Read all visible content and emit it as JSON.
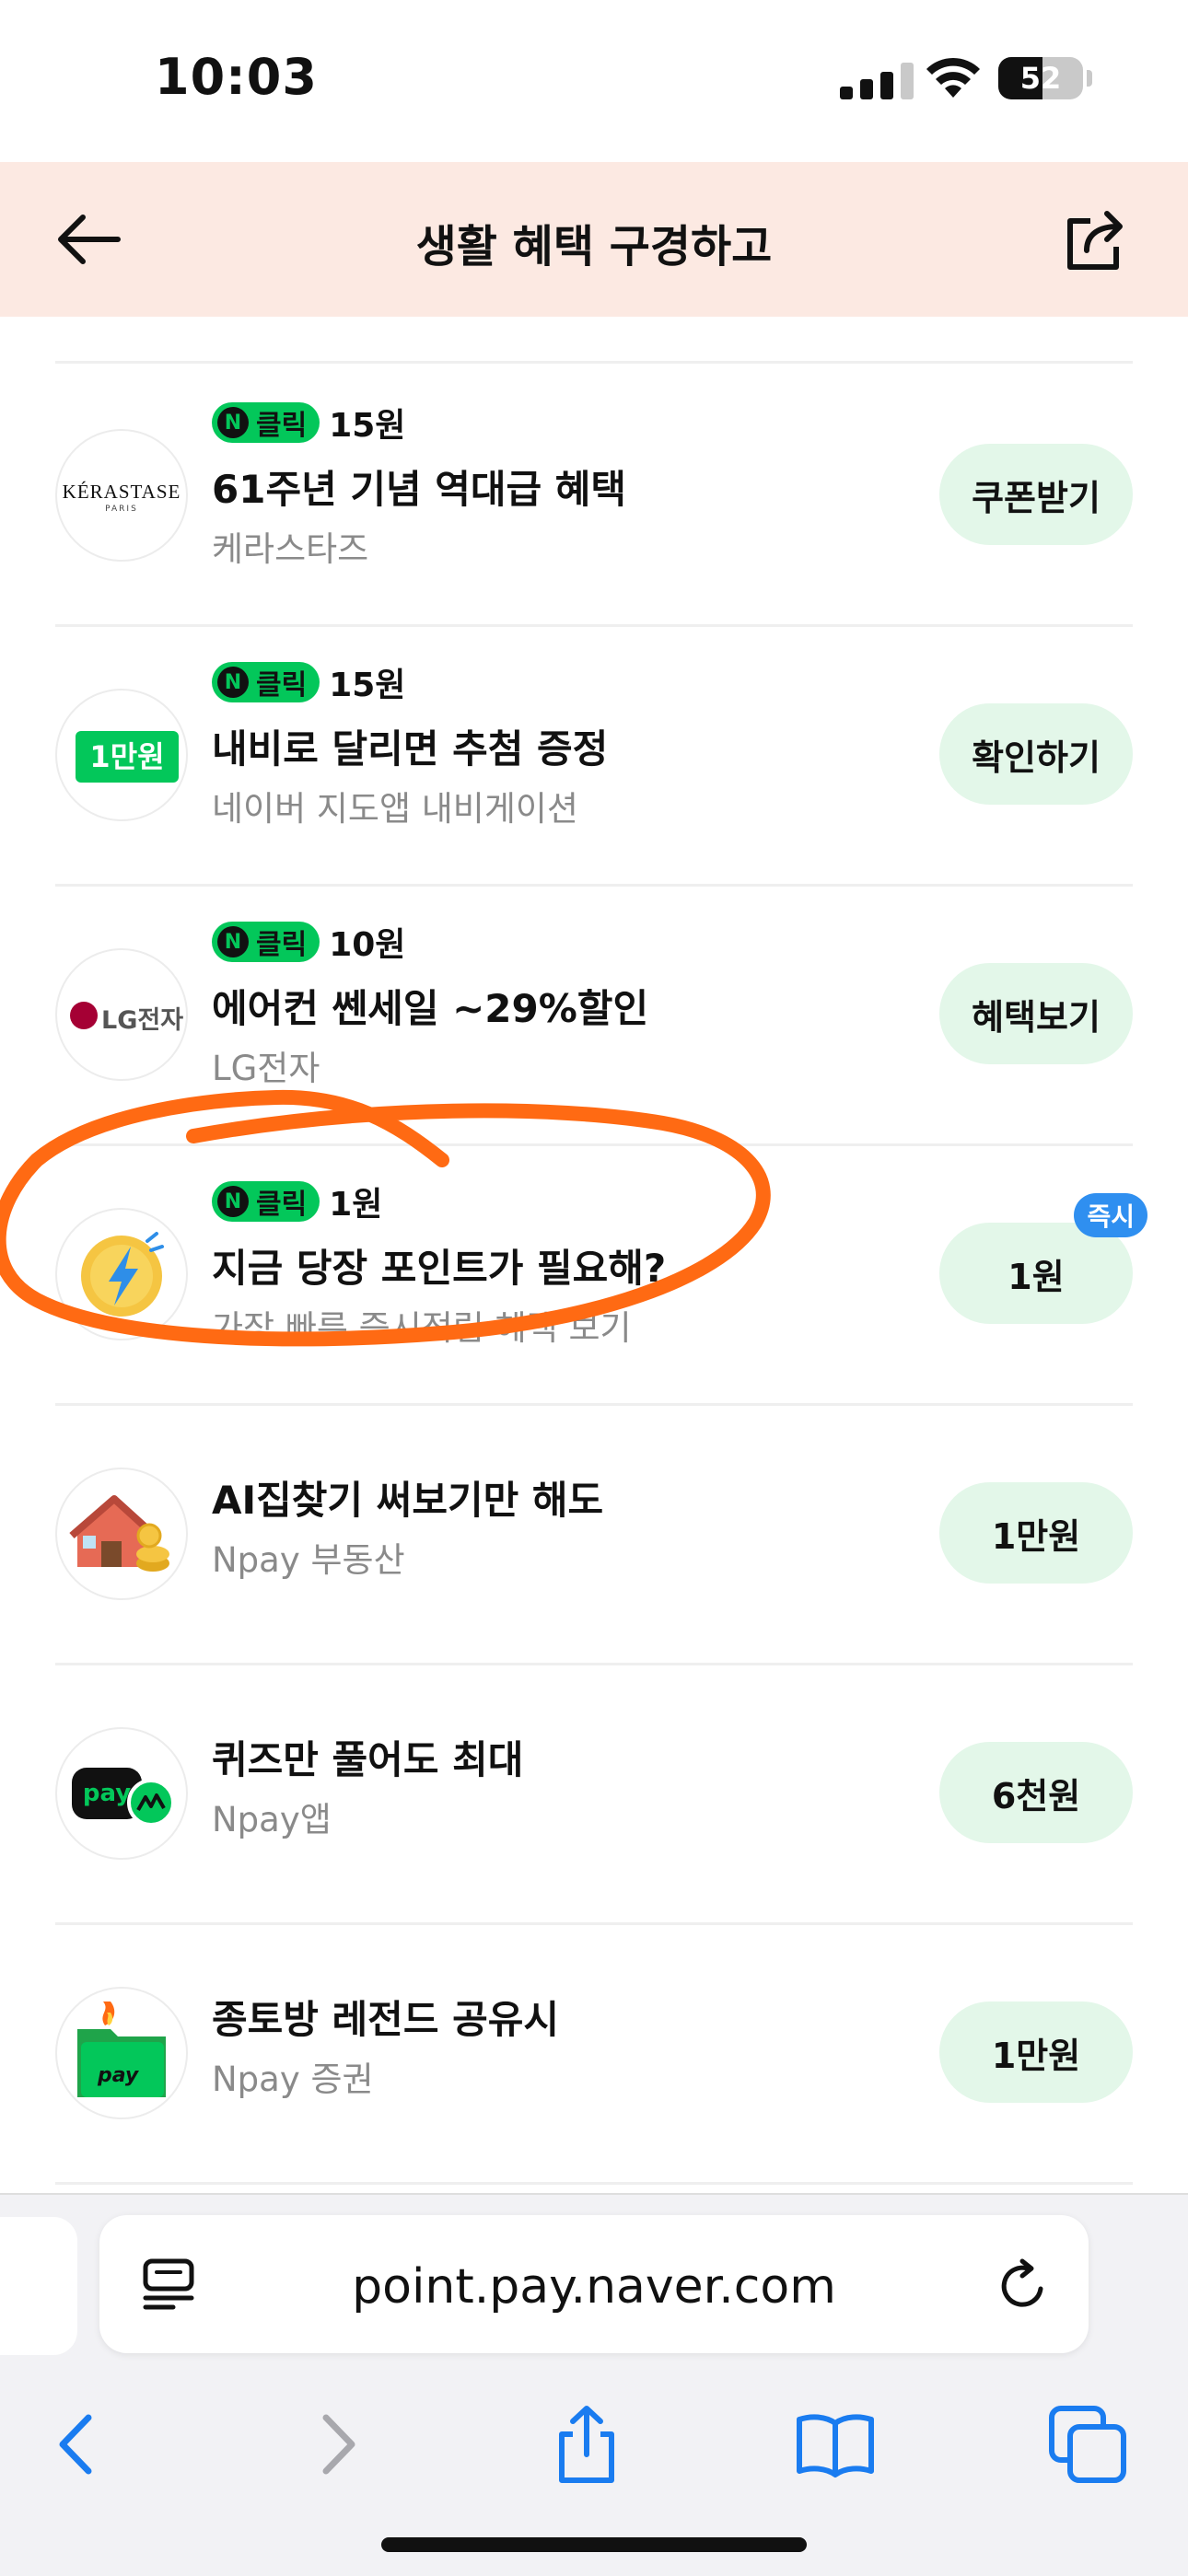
{
  "status_bar": {
    "time": "10:03",
    "battery": "52"
  },
  "header": {
    "title": "생활 혜택 구경하고"
  },
  "items": [
    {
      "badge_label": "클릭",
      "amount": "15원",
      "title": "61주년 기념 역대급 혜택",
      "subtitle": "케라스타즈",
      "action": "쿠폰받기",
      "logo_text": "KÉRASTASE",
      "logo_sub": "PARIS"
    },
    {
      "badge_label": "클릭",
      "amount": "15원",
      "title": "내비로 달리면 추첨 증정",
      "subtitle": "네이버 지도앱 내비게이션",
      "action": "확인하기",
      "logo_text": "1만원"
    },
    {
      "badge_label": "클릭",
      "amount": "10원",
      "title": "에어컨 쎈세일 ~29%할인",
      "subtitle": "LG전자",
      "action": "혜택보기",
      "logo_text": "LG전자"
    },
    {
      "badge_label": "클릭",
      "amount": "1원",
      "title": "지금 당장 포인트가 필요해?",
      "subtitle": "가장 빠른 즉시적립 혜택 보기",
      "action": "1원",
      "tag": "즉시"
    },
    {
      "title": "AI집찾기 써보기만 해도",
      "subtitle": "Npay 부동산",
      "action": "1만원"
    },
    {
      "title": "퀴즈만 풀어도 최대",
      "subtitle": "Npay앱",
      "action": "6천원",
      "logo_text": "pay"
    },
    {
      "title": "종토방 레전드 공유시",
      "subtitle": "Npay 증권",
      "action": "1만원",
      "logo_text": "pay"
    }
  ],
  "browser": {
    "url": "point.pay.naver.com"
  },
  "colors": {
    "header_bg": "#fce9e2",
    "badge_green": "#03c75a",
    "action_bg": "#e3f7e9",
    "annotation": "#ff6a13",
    "tag_blue": "#2f8ff0",
    "browser_blue": "#1a7cf0"
  }
}
